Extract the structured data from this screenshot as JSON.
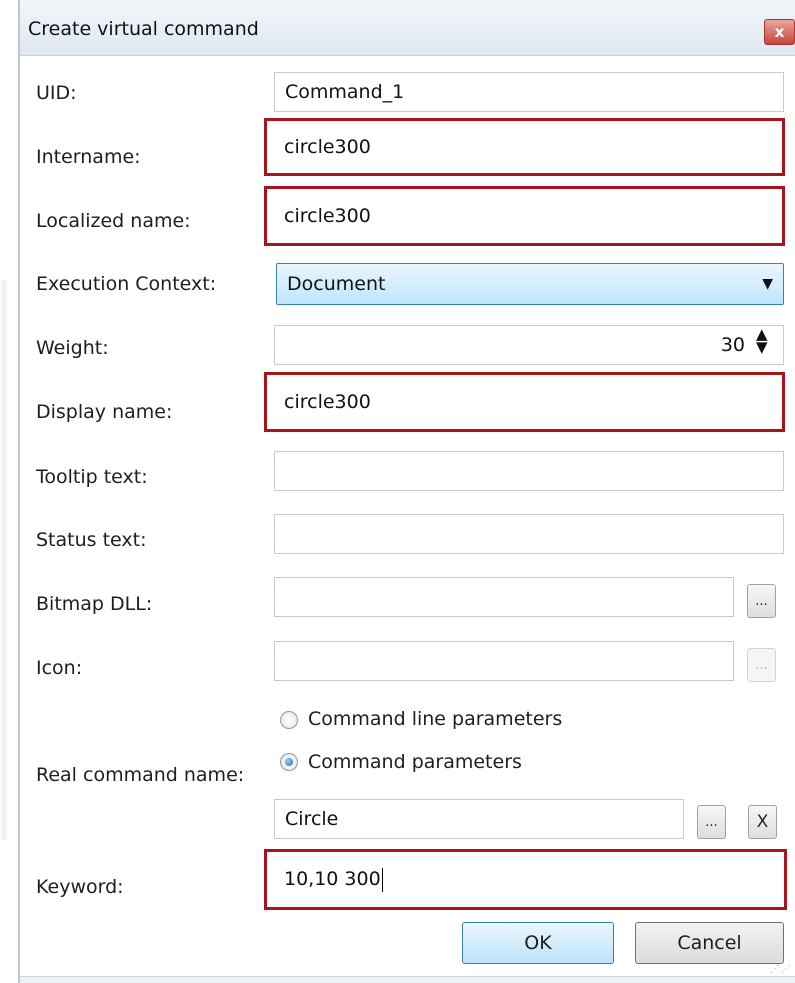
{
  "dialog": {
    "title": "Create virtual command",
    "close_glyph": "x"
  },
  "fields": {
    "uid": {
      "label": "UID:",
      "value": "Command_1"
    },
    "intername": {
      "label": "Intername:",
      "value": "circle300"
    },
    "localized_name": {
      "label": "Localized name:",
      "value": "circle300"
    },
    "execution_context": {
      "label": "Execution Context:",
      "value": "Document"
    },
    "weight": {
      "label": "Weight:",
      "value": "30"
    },
    "display_name": {
      "label": "Display name:",
      "value": "circle300"
    },
    "tooltip_text": {
      "label": "Tooltip text:",
      "value": ""
    },
    "status_text": {
      "label": "Status text:",
      "value": ""
    },
    "bitmap_dll": {
      "label": "Bitmap DLL:",
      "value": "",
      "browse_label": "..."
    },
    "icon": {
      "label": "Icon:",
      "value": "",
      "browse_label": "..."
    },
    "real_command_name": {
      "label": "Real command name:",
      "option_command_line": "Command line parameters",
      "option_command_params": "Command parameters",
      "selected": "Command parameters",
      "value": "Circle",
      "browse_label": "...",
      "clear_label": "X"
    },
    "keyword": {
      "label": "Keyword:",
      "value": "10,10 300"
    }
  },
  "buttons": {
    "ok": "OK",
    "cancel": "Cancel"
  },
  "colors": {
    "highlight_border": "#a8141d",
    "focus_blue": "#3c7fb1"
  }
}
